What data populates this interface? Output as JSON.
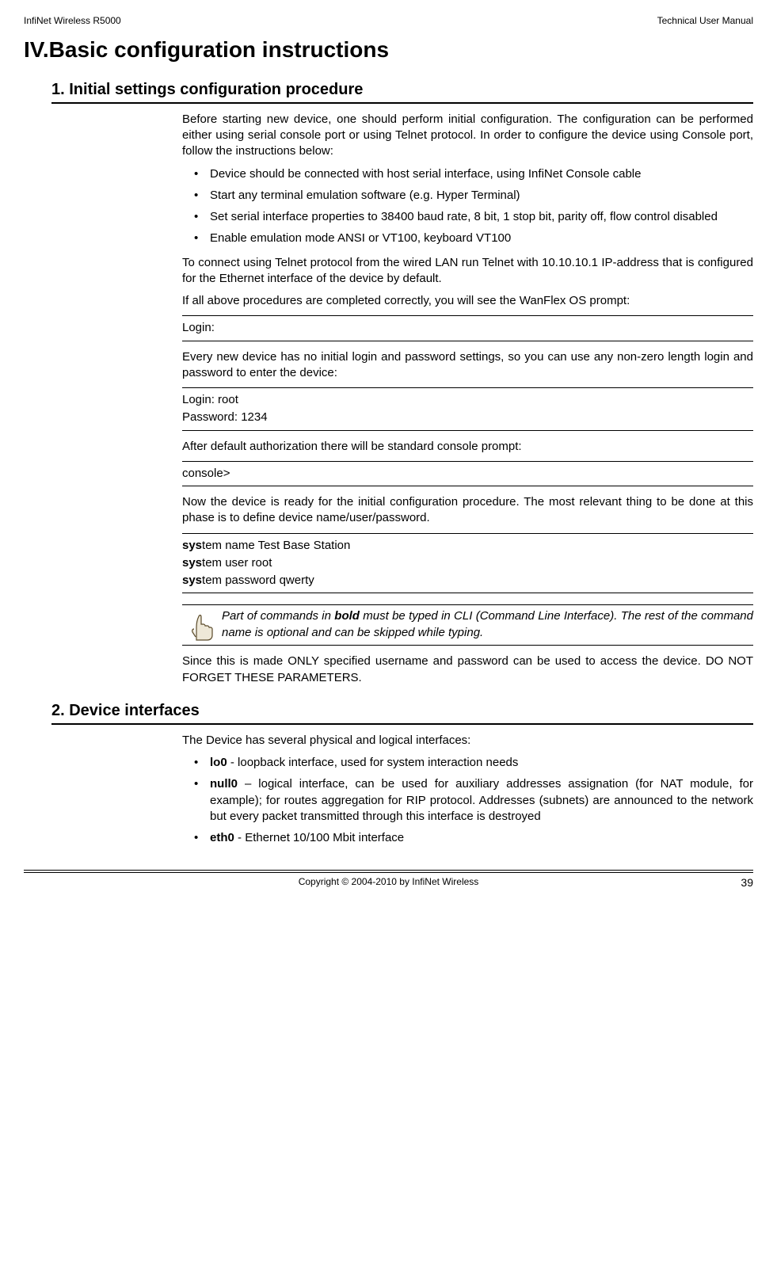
{
  "header": {
    "left": "InfiNet Wireless R5000",
    "right": "Technical User Manual"
  },
  "chapter_title": "IV.Basic configuration instructions",
  "section1": {
    "title": "1. Initial settings configuration procedure",
    "p1": "Before starting new device, one should perform initial configuration. The configuration can be performed either using serial console port or using Telnet protocol. In order to configure the device using Console port, follow the instructions below:",
    "bullets1": [
      "Device should be connected with host serial interface, using InfiNet Console cable",
      "Start any terminal emulation software (e.g. Hyper Terminal)",
      "Set serial interface properties to 38400 baud rate, 8 bit, 1 stop bit, parity off, flow control disabled",
      "Enable emulation mode ANSI or VT100, keyboard VT100"
    ],
    "p2": "To connect using Telnet protocol from the wired LAN run Telnet with 10.10.10.1 IP-address that is configured for the Ethernet interface of the device by default.",
    "p3": "If all above procedures are completed correctly, you will see the WanFlex OS prompt:",
    "cmd1": "Login:",
    "p4": "Every new device has no initial login and password settings, so you can use any non-zero length login and password to enter the device:",
    "cmd2a": "Login: root",
    "cmd2b": "Password: 1234",
    "p5": "After default authorization there will be standard console prompt:",
    "cmd3": " console>",
    "p6": "Now the device is ready for the initial configuration procedure. The most relevant thing to be done at this phase is to define device name/user/password.",
    "cmd4a_prefix": "sys",
    "cmd4a_rest": "tem name Test Base Station",
    "cmd4b_prefix": "sys",
    "cmd4b_rest": "tem user root",
    "cmd4c_prefix": "sys",
    "cmd4c_rest": "tem password qwerty",
    "note_pre": "Part of commands in ",
    "note_bold": "bold",
    "note_post": " must be typed in CLI (Command Line Interface). The rest of the command name is optional and can be skipped while typing.",
    "p7": "Since this is made ONLY specified username and password can be used to access the device. DO NOT FORGET THESE PARAMETERS."
  },
  "section2": {
    "title": "2. Device interfaces",
    "p1": "The Device has several physical and logical interfaces:",
    "items": [
      {
        "label": "lo0",
        "sep": "    - ",
        "text": "loopback interface, used for system interaction needs"
      },
      {
        "label": "null0",
        "sep": " – ",
        "text": "logical interface, can be used for auxiliary addresses assignation (for NAT module, for example); for routes aggregation for RIP protocol. Addresses (subnets) are announced to the network but every packet transmitted through this interface is destroyed"
      },
      {
        "label": "eth0",
        "sep": " - ",
        "text": "Ethernet 10/100 Mbit interface"
      }
    ]
  },
  "footer": {
    "copyright": "Copyright © 2004-2010 by InfiNet Wireless",
    "page": "39"
  }
}
